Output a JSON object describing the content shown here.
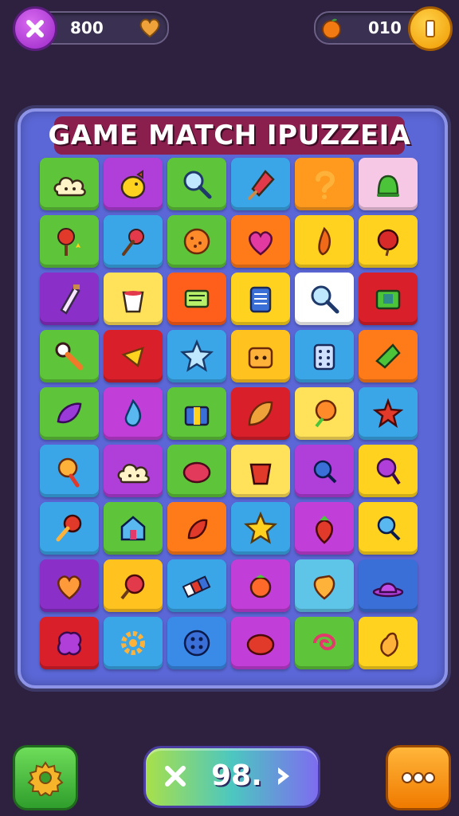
{
  "hud": {
    "score": "800",
    "coins": "010",
    "score_icon": "heart-icon",
    "coins_icon": "orange-fruit-icon"
  },
  "board": {
    "title": "GAME MATCH IPUZZEIA"
  },
  "bottom_bar": {
    "counter": "98."
  },
  "colors": {
    "background": "#2e2140",
    "board": "#5b67d6",
    "title_banner": "#8a1f4e"
  },
  "tiles": [
    [
      "cloud",
      "lemon-bird",
      "magnifier",
      "popsicle",
      "question-swirl",
      "green-bell"
    ],
    [
      "red-tree",
      "rose",
      "orange-cookie",
      "heart",
      "leaf-flame",
      "red-berry"
    ],
    [
      "bottle",
      "cup",
      "green-box",
      "notepad",
      "magnifier",
      "money-box"
    ],
    [
      "key-tool",
      "spinning-top",
      "star",
      "toaster",
      "calculator",
      "leaf-kite"
    ],
    [
      "purple-leaf",
      "blue-drop",
      "gift-box",
      "orange-leaf",
      "green-balloon",
      "red-star"
    ],
    [
      "orange-cup",
      "cloud",
      "red-blob",
      "red-cup",
      "blue-knot",
      "purple-lollipop"
    ],
    [
      "lollipop-ring",
      "house",
      "red-pepper",
      "gold-star",
      "strawberry",
      "blue-lens"
    ],
    [
      "orange-heart",
      "apple-bomb",
      "rainbow-eraser",
      "tomato",
      "orange-heart-jar",
      "purple-hat"
    ],
    [
      "red-amoeba",
      "sun-gear",
      "blue-button",
      "red-disc",
      "green-swirl",
      "orange-pear"
    ]
  ],
  "tile_colors": [
    [
      "#5ec43a",
      "#b03ed8",
      "#5ec43a",
      "#3aa6e8",
      "#ff9a1f",
      "#f6c8e6"
    ],
    [
      "#5ec43a",
      "#3aa6e8",
      "#5ec43a",
      "#ff7b1a",
      "#ffd21f",
      "#ffd21f"
    ],
    [
      "#8a2fc8",
      "#ffe15a",
      "#ff5f1a",
      "#ffd21f",
      "#ffffff",
      "#d91f2a"
    ],
    [
      "#5ec43a",
      "#d91f2a",
      "#3aa6e8",
      "#ffc21f",
      "#3aa6e8",
      "#ff7b1a"
    ],
    [
      "#5ec43a",
      "#c23ed8",
      "#5ec43a",
      "#d91f2a",
      "#ffe15a",
      "#3aa6e8"
    ],
    [
      "#3aa6e8",
      "#b03ed8",
      "#5ec43a",
      "#ffe15a",
      "#b03ed8",
      "#ffd21f"
    ],
    [
      "#3aa6e8",
      "#5ec43a",
      "#ff7b1a",
      "#3aa6e8",
      "#c23ed8",
      "#ffd21f"
    ],
    [
      "#8a2fc8",
      "#ffc21f",
      "#3aa6e8",
      "#c23ed8",
      "#5ec4e8",
      "#3a6fd8"
    ],
    [
      "#d91f2a",
      "#3aa6e8",
      "#3a8ae8",
      "#c23ed8",
      "#5ec43a",
      "#ffd21f"
    ]
  ]
}
